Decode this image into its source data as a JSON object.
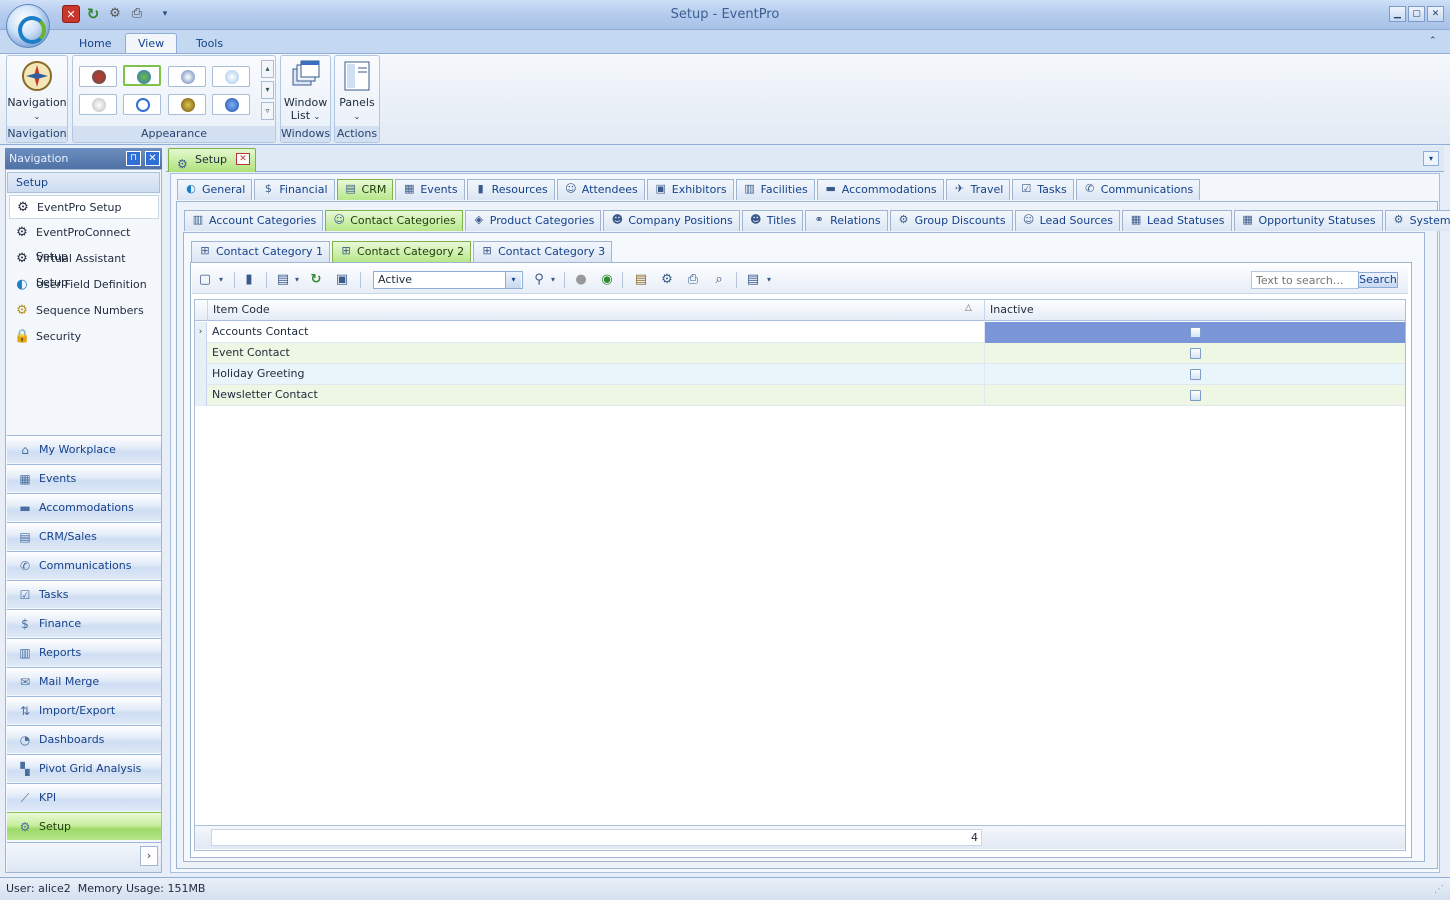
{
  "window": {
    "title": "Setup - EventPro",
    "min": "▁",
    "max": "▢",
    "close": "✕"
  },
  "ribbon": {
    "tabs": [
      {
        "label": "Home"
      },
      {
        "label": "View"
      },
      {
        "label": "Tools"
      }
    ],
    "groups": {
      "navigation": {
        "button": "Navigation",
        "label": "Navigation"
      },
      "appearance": {
        "label": "Appearance"
      },
      "windows": {
        "button_line1": "Window",
        "button_line2": "List",
        "label": "Windows"
      },
      "actions": {
        "button": "Panels",
        "label": "Actions"
      }
    }
  },
  "nav": {
    "header": "Navigation",
    "section": "Setup",
    "links": [
      {
        "label": "EventPro Setup",
        "icon": "gear-icon"
      },
      {
        "label": "EventProConnect Setup",
        "icon": "gear-icon"
      },
      {
        "label": "Virtual Assistant Setup",
        "icon": "gear-icon"
      },
      {
        "label": "User Field Definition",
        "icon": "eventpro-icon"
      },
      {
        "label": "Sequence Numbers",
        "icon": "gears-icon"
      },
      {
        "label": "Security",
        "icon": "lock-icon"
      }
    ],
    "modules": [
      {
        "label": "My Workplace"
      },
      {
        "label": "Events"
      },
      {
        "label": "Accommodations"
      },
      {
        "label": "CRM/Sales"
      },
      {
        "label": "Communications"
      },
      {
        "label": "Tasks"
      },
      {
        "label": "Finance"
      },
      {
        "label": "Reports"
      },
      {
        "label": "Mail Merge"
      },
      {
        "label": "Import/Export"
      },
      {
        "label": "Dashboards"
      },
      {
        "label": "Pivot Grid Analysis"
      },
      {
        "label": "KPI"
      },
      {
        "label": "Setup"
      }
    ]
  },
  "document": {
    "tab": "Setup"
  },
  "tabs_level1": [
    "General",
    "Financial",
    "CRM",
    "Events",
    "Resources",
    "Attendees",
    "Exhibitors",
    "Facilities",
    "Accommodations",
    "Travel",
    "Tasks",
    "Communications"
  ],
  "tabs_level2": [
    "Account Categories",
    "Contact Categories",
    "Product Categories",
    "Company Positions",
    "Titles",
    "Relations",
    "Group Discounts",
    "Lead Sources",
    "Lead Statuses",
    "Opportunity Statuses",
    "System Settings"
  ],
  "tabs_level3": [
    "Contact Category 1",
    "Contact Category 2",
    "Contact Category 3"
  ],
  "toolbar": {
    "filter_value": "Active",
    "search_placeholder": "Text to search...",
    "search_label": "Search"
  },
  "grid": {
    "columns": {
      "code": "Item Code",
      "inactive": "Inactive"
    },
    "rows": [
      {
        "code": "Accounts Contact"
      },
      {
        "code": "Event Contact"
      },
      {
        "code": "Holiday Greeting"
      },
      {
        "code": "Newsletter Contact"
      }
    ],
    "footer_count": "4"
  },
  "status": {
    "text": "User: alice2  Memory Usage: 151MB"
  },
  "colors": {
    "accent_green": "#aee27a",
    "ribbon_blue": "#c4d8f2",
    "selection": "#7a96d9"
  }
}
